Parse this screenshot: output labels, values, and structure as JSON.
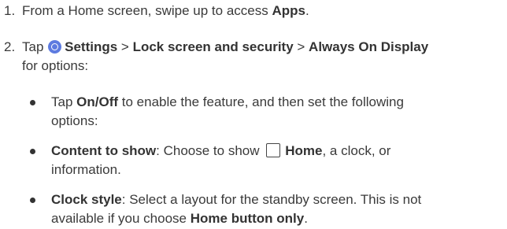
{
  "steps": [
    {
      "number": "1.",
      "parts": [
        {
          "t": "From a Home screen, swipe up to access ",
          "b": false
        },
        {
          "t": "Apps",
          "b": true
        },
        {
          "t": ".",
          "b": false
        }
      ]
    },
    {
      "number": "2.",
      "line1": [
        {
          "t": "Tap ",
          "b": false
        },
        {
          "icon": "gear-icon"
        },
        {
          "t": "Settings",
          "b": true
        },
        {
          "t": " > ",
          "b": false
        },
        {
          "t": "Lock screen and security",
          "b": true
        },
        {
          "t": " > ",
          "b": false
        },
        {
          "t": "Always On Display",
          "b": true
        }
      ],
      "line2": "for options:"
    }
  ],
  "bullets": [
    {
      "lines": [
        [
          {
            "t": "Tap ",
            "b": false
          },
          {
            "t": "On/Off",
            "b": true
          },
          {
            "t": " to enable the feature, and then set the following",
            "b": false
          }
        ],
        [
          {
            "t": "options:",
            "b": false
          }
        ]
      ]
    },
    {
      "lines": [
        [
          {
            "t": "Content to show",
            "b": true
          },
          {
            "t": ": Choose to show ",
            "b": false
          },
          {
            "icon": "home-icon"
          },
          {
            "t": "Home",
            "b": true
          },
          {
            "t": ", a clock, or",
            "b": false
          }
        ],
        [
          {
            "t": "information.",
            "b": false
          }
        ]
      ]
    },
    {
      "lines": [
        [
          {
            "t": "Clock style",
            "b": true
          },
          {
            "t": ": Select a layout for the standby screen. This is not",
            "b": false
          }
        ],
        [
          {
            "t": "available if you choose ",
            "b": false
          },
          {
            "t": "Home button only",
            "b": true
          },
          {
            "t": ".",
            "b": false
          }
        ]
      ]
    }
  ]
}
